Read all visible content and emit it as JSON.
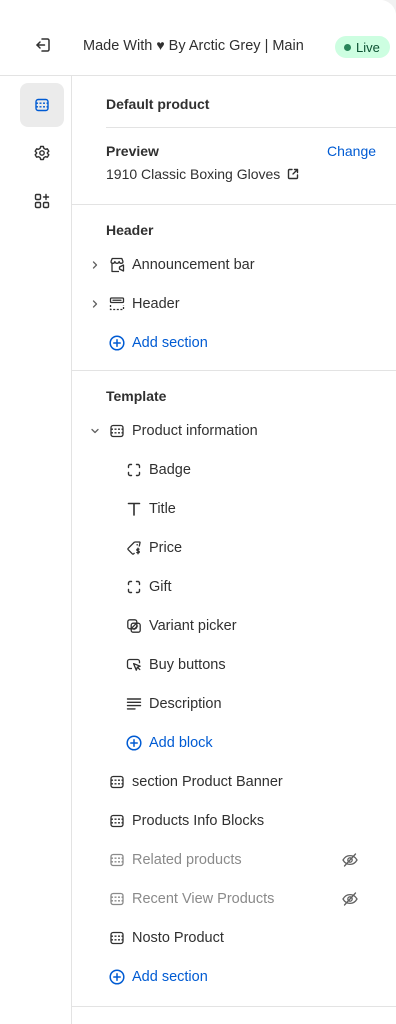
{
  "topbar": {
    "title_prefix": "Made With ",
    "heart": "♥",
    "title_suffix": " By Arctic Grey | Main",
    "live_label": "Live"
  },
  "panel": {
    "page_title": "Default product",
    "preview": {
      "label": "Preview",
      "change_label": "Change",
      "product_name": "1910 Classic Boxing Gloves"
    },
    "header_group": {
      "title": "Header",
      "sections": [
        {
          "label": "Announcement bar",
          "icon": "announcement-icon"
        },
        {
          "label": "Header",
          "icon": "header-layout-icon"
        }
      ],
      "add_label": "Add section"
    },
    "template_group": {
      "title": "Template",
      "product_information": {
        "label": "Product information",
        "icon": "section-icon",
        "blocks": [
          {
            "label": "Badge",
            "icon": "dashed-frame-icon"
          },
          {
            "label": "Title",
            "icon": "text-icon"
          },
          {
            "label": "Price",
            "icon": "price-tag-icon"
          },
          {
            "label": "Gift",
            "icon": "dashed-frame-icon"
          },
          {
            "label": "Variant picker",
            "icon": "variant-icon"
          },
          {
            "label": "Buy buttons",
            "icon": "cursor-button-icon"
          },
          {
            "label": "Description",
            "icon": "text-lines-icon"
          }
        ],
        "add_block_label": "Add block"
      },
      "sections": [
        {
          "label": "section Product Banner",
          "hidden": false
        },
        {
          "label": "Products Info Blocks",
          "hidden": false
        },
        {
          "label": "Related products",
          "hidden": true
        },
        {
          "label": "Recent View Products",
          "hidden": true
        },
        {
          "label": "Nosto Product",
          "hidden": false
        }
      ],
      "add_label": "Add section"
    }
  },
  "colors": {
    "accent": "#005bd3",
    "live_bg": "#cdfee1",
    "live_text": "#0c5132",
    "muted_text": "#8a8a8a"
  }
}
